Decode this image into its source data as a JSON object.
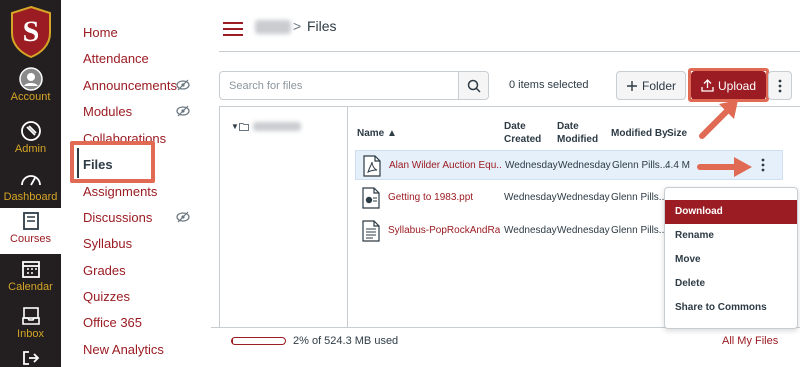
{
  "global_nav": {
    "items": [
      {
        "label": "Account",
        "icon": "account-icon"
      },
      {
        "label": "Admin",
        "icon": "admin-icon"
      },
      {
        "label": "Dashboard",
        "icon": "dashboard-icon"
      },
      {
        "label": "Courses",
        "icon": "courses-icon",
        "active": true
      },
      {
        "label": "Calendar",
        "icon": "calendar-icon"
      },
      {
        "label": "Inbox",
        "icon": "inbox-icon"
      },
      {
        "label": "",
        "icon": "logout-icon"
      }
    ]
  },
  "course_nav": {
    "items": [
      {
        "label": "Home"
      },
      {
        "label": "Attendance"
      },
      {
        "label": "Announcements",
        "hidden_icon": true
      },
      {
        "label": "Modules",
        "hidden_icon": true
      },
      {
        "label": "Collaborations"
      },
      {
        "label": "Files",
        "active": true
      },
      {
        "label": "Assignments"
      },
      {
        "label": "Discussions",
        "hidden_icon": true
      },
      {
        "label": "Syllabus"
      },
      {
        "label": "Grades"
      },
      {
        "label": "Quizzes"
      },
      {
        "label": "Office 365"
      },
      {
        "label": "New Analytics"
      }
    ]
  },
  "header": {
    "breadcrumb_separator": ">",
    "breadcrumb_current": "Files"
  },
  "toolbar": {
    "search_placeholder": "Search for files",
    "items_selected": "0 items selected",
    "folder_label": "Folder",
    "upload_label": "Upload"
  },
  "table": {
    "headers": {
      "name": "Name ▲",
      "date_created": "Date Created",
      "date_modified": "Date Modified",
      "modified_by": "Modified By",
      "size": "Size"
    },
    "rows": [
      {
        "name": "Alan Wilder Auction Equ...",
        "created": "Wednesday",
        "modified": "Wednesday",
        "modified_by": "Glenn Pills...",
        "size": "4.4 M",
        "icon": "pdf-file-icon",
        "selected": true
      },
      {
        "name": "Getting to 1983.ppt",
        "created": "Wednesday",
        "modified": "Wednesday",
        "modified_by": "Glenn Pills...",
        "size": "",
        "icon": "presentation-file-icon"
      },
      {
        "name": "Syllabus-PopRockAndRa...",
        "created": "Wednesday",
        "modified": "Wednesday",
        "modified_by": "Glenn Pills...",
        "size": "",
        "icon": "document-file-icon"
      }
    ]
  },
  "context_menu": {
    "items": [
      {
        "label": "Download",
        "active": true
      },
      {
        "label": "Rename"
      },
      {
        "label": "Move"
      },
      {
        "label": "Delete"
      },
      {
        "label": "Share to Commons"
      }
    ]
  },
  "footer": {
    "quota_text": "2% of 524.3 MB used",
    "quota_fraction": 0.02,
    "all_my_files": "All My Files"
  },
  "colors": {
    "brand": "#9b1c23",
    "nav_bg": "#231f20",
    "nav_label": "#d5a526",
    "annotation": "#e06a53"
  }
}
